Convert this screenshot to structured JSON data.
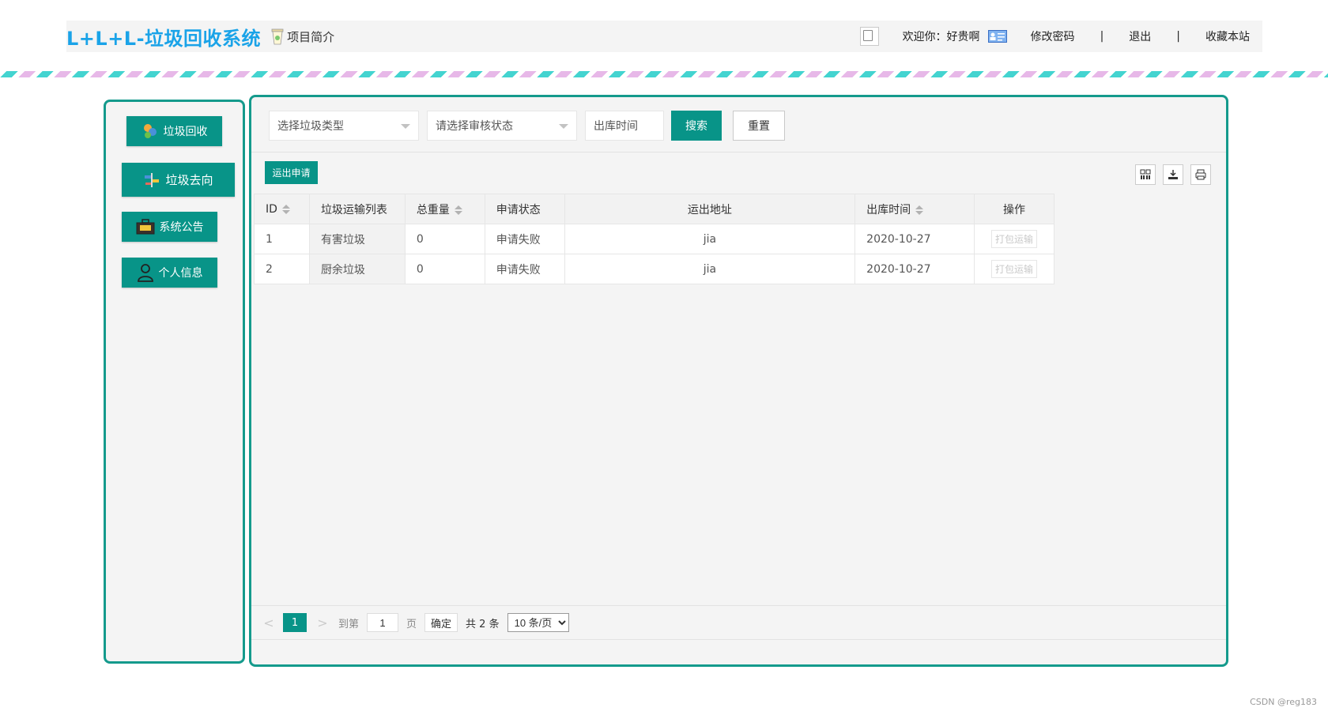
{
  "header": {
    "brand": "L+L+L-垃圾回收系统",
    "intro_label": "项目简介",
    "welcome": "欢迎你：好贵啊",
    "change_password": "修改密码",
    "separator": "|",
    "logout": "退出",
    "bookmark": "收藏本站"
  },
  "sidebar": {
    "items": [
      {
        "label": "垃圾回收",
        "icon": "recycle-icon"
      },
      {
        "label": "垃圾去向",
        "icon": "signpost-icon"
      },
      {
        "label": "系统公告",
        "icon": "briefcase-icon"
      },
      {
        "label": "个人信息",
        "icon": "user-icon"
      }
    ]
  },
  "filters": {
    "type_placeholder": "选择垃圾类型",
    "status_placeholder": "请选择审核状态",
    "date_placeholder": "出库时间",
    "search_label": "搜索",
    "reset_label": "重置"
  },
  "toolbar": {
    "apply_label": "运出申请"
  },
  "table": {
    "columns": [
      "ID",
      "垃圾运输列表",
      "总重量",
      "申请状态",
      "运出地址",
      "出库时间",
      "操作"
    ],
    "rows": [
      {
        "id": "1",
        "name": "有害垃圾",
        "weight": "0",
        "status": "申请失败",
        "address": "jia",
        "date": "2020-10-27",
        "action": "打包运输"
      },
      {
        "id": "2",
        "name": "厨余垃圾",
        "weight": "0",
        "status": "申请失败",
        "address": "jia",
        "date": "2020-10-27",
        "action": "打包运输"
      }
    ]
  },
  "pager": {
    "prev": "<",
    "current": "1",
    "next": ">",
    "goto_label": "到第",
    "page_input": "1",
    "page_unit": "页",
    "ok_label": "确定",
    "total": "共 2 条",
    "page_size": "10 条/页"
  },
  "watermark": "CSDN @reg183",
  "colors": {
    "primary": "#089488",
    "brand": "#1aa3e8",
    "fail": "#c71585"
  }
}
